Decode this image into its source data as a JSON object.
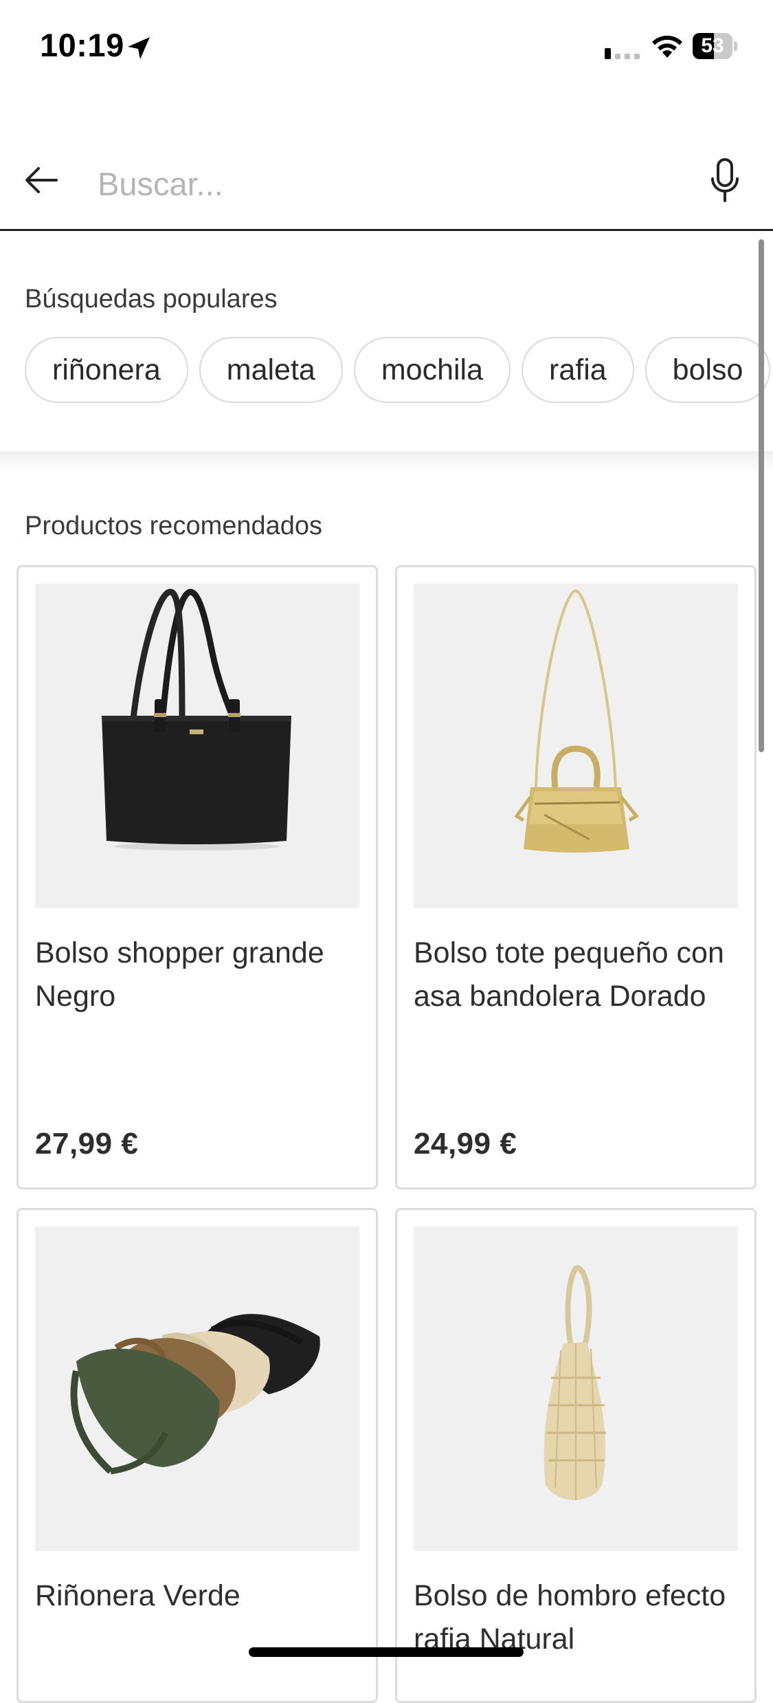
{
  "status_bar": {
    "time": "10:19",
    "battery": "53",
    "battery_level": 0.53
  },
  "search": {
    "placeholder": "Buscar...",
    "value": ""
  },
  "popular": {
    "title": "Búsquedas populares",
    "chips": [
      "riñonera",
      "maleta",
      "mochila",
      "rafia",
      "bolso"
    ]
  },
  "recommended": {
    "title": "Productos recomendados",
    "products": [
      {
        "name": "Bolso shopper grande Negro",
        "price": "27,99 €"
      },
      {
        "name": "Bolso tote pequeño con asa bandolera Dorado",
        "price": "24,99 €"
      },
      {
        "name": "Riñonera Verde",
        "price": ""
      },
      {
        "name": "Bolso de hombro efecto rafia Natural",
        "price": ""
      }
    ]
  },
  "icons": {
    "back": "arrow-left-icon",
    "mic": "microphone-icon",
    "location": "location-arrow-icon",
    "signal": "cellular-signal-icon",
    "wifi": "wifi-icon",
    "battery": "battery-icon"
  }
}
